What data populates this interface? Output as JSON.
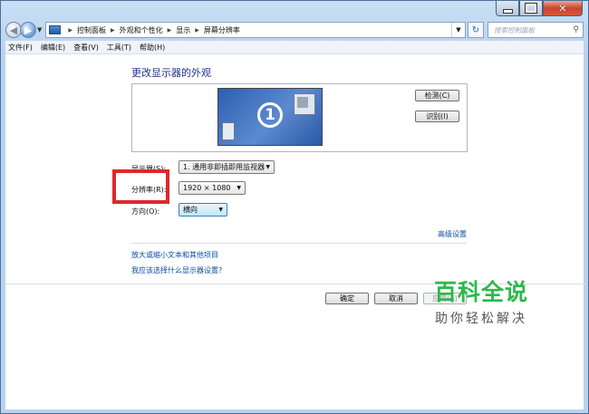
{
  "window": {
    "caption_buttons": {
      "minimize": "minimize-icon",
      "maximize": "maximize-icon",
      "close": "close-icon"
    }
  },
  "address_bar": {
    "breadcrumbs": [
      "控制面板",
      "外观和个性化",
      "显示",
      "屏幕分辨率"
    ],
    "search_placeholder": "搜索控制面板"
  },
  "menu": [
    "文件(F)",
    "编辑(E)",
    "查看(V)",
    "工具(T)",
    "帮助(H)"
  ],
  "main": {
    "title": "更改显示器的外观",
    "monitor_number": "1",
    "detect_button": "检测(C)",
    "identify_button": "识别(I)",
    "display_label": "显示器(S):",
    "display_value": "1. 通用非即插即用监视器",
    "resolution_label": "分辨率(R):",
    "resolution_value": "1920 × 1080",
    "orientation_label": "方向(O):",
    "orientation_value": "横向",
    "advanced_link": "高级设置",
    "link_1": "放大或缩小文本和其他项目",
    "link_2": "我应该选择什么显示器设置?",
    "ok_button": "确定",
    "cancel_button": "取消",
    "apply_button": "应用(A)"
  },
  "watermark": {
    "line1": "百科全说",
    "line2": "助你轻松解决"
  },
  "colors": {
    "highlight_box": "#e0262d",
    "link": "#0b4ea2",
    "watermark": "#2db84d"
  }
}
